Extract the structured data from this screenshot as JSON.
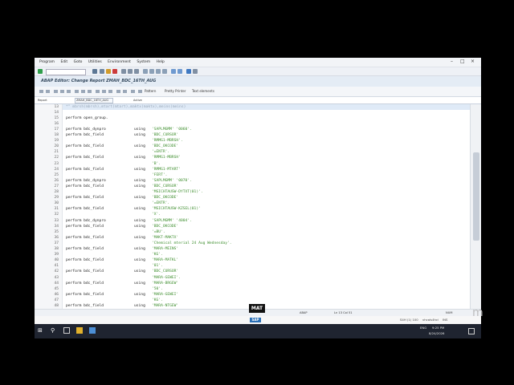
{
  "menu": [
    "Program",
    "Edit",
    "Goto",
    "Utilities",
    "Environment",
    "System",
    "Help"
  ],
  "window_title": "ABAP Editor: Change Report ZMAH_BDC_16TH_AUG",
  "toolbar2_labels": [
    "Pattern",
    "Pretty Printer",
    "Text elements"
  ],
  "info": {
    "report_label": "Report",
    "report_value": "ZMAH_BDC_16TH_AUG",
    "status": "Active"
  },
  "code_lines": [
    {
      "num": "13",
      "text": "*\" mbrsh(mbrsh),mtart(mtart),maktx(maktx),meins(meins)"
    },
    {
      "num": "14",
      "text": ""
    },
    {
      "num": "15",
      "text": "perform open_group."
    },
    {
      "num": "16",
      "text": ""
    },
    {
      "num": "17",
      "a": "perform bdc_dynpro",
      "b": "using",
      "c": "'SAPLMGMM' '0060'."
    },
    {
      "num": "18",
      "a": "perform bdc_field",
      "b": "using",
      "c": "'BDC_CURSOR'"
    },
    {
      "num": "19",
      "a": "",
      "b": "",
      "c": "'RMMG1-MBRSH'."
    },
    {
      "num": "20",
      "a": "perform bdc_field",
      "b": "using",
      "c": "'BDC_OKCODE'"
    },
    {
      "num": "21",
      "a": "",
      "b": "",
      "c": "'=ENTR'."
    },
    {
      "num": "22",
      "a": "perform bdc_field",
      "b": "using",
      "c": "'RMMG1-MBRSH'"
    },
    {
      "num": "23",
      "a": "",
      "b": "",
      "c": "'B'."
    },
    {
      "num": "24",
      "a": "perform bdc_field",
      "b": "using",
      "c": "'RMMG1-MTART'"
    },
    {
      "num": "25",
      "a": "",
      "b": "",
      "c": "'FERT'."
    },
    {
      "num": "26",
      "a": "perform bdc_dynpro",
      "b": "using",
      "c": "'SAPLMGMM' '0070'."
    },
    {
      "num": "27",
      "a": "perform bdc_field",
      "b": "using",
      "c": "'BDC_CURSOR'"
    },
    {
      "num": "28",
      "a": "",
      "b": "",
      "c": "'MSICHTAUSW-DYTXT(01)'."
    },
    {
      "num": "29",
      "a": "perform bdc_field",
      "b": "using",
      "c": "'BDC_OKCODE'"
    },
    {
      "num": "30",
      "a": "",
      "b": "",
      "c": "'=ENTR'."
    },
    {
      "num": "31",
      "a": "perform bdc_field",
      "b": "using",
      "c": "'MSICHTAUSW-KZSEL(01)'"
    },
    {
      "num": "32",
      "a": "",
      "b": "",
      "c": "'X'."
    },
    {
      "num": "33",
      "a": "perform bdc_dynpro",
      "b": "using",
      "c": "'SAPLMGMM' '4004'."
    },
    {
      "num": "34",
      "a": "perform bdc_field",
      "b": "using",
      "c": "'BDC_OKCODE'"
    },
    {
      "num": "35",
      "a": "",
      "b": "",
      "c": "'=BU'."
    },
    {
      "num": "36",
      "a": "perform bdc_field",
      "b": "using",
      "c": "'MAKT-MAKTX'"
    },
    {
      "num": "37",
      "a": "",
      "b": "",
      "c": "'Chemical mterial 24 Aug Wednesday'."
    },
    {
      "num": "38",
      "a": "perform bdc_field",
      "b": "using",
      "c": "'MARA-MEINS'"
    },
    {
      "num": "39",
      "a": "",
      "b": "",
      "c": "'KG'."
    },
    {
      "num": "40",
      "a": "perform bdc_field",
      "b": "using",
      "c": "'MARA-MATKL'"
    },
    {
      "num": "41",
      "a": "",
      "b": "",
      "c": "'01'."
    },
    {
      "num": "42",
      "a": "perform bdc_field",
      "b": "using",
      "c": "'BDC_CURSOR'"
    },
    {
      "num": "43",
      "a": "",
      "b": "",
      "c": "'MARA-GEWEI'."
    },
    {
      "num": "44",
      "a": "perform bdc_field",
      "b": "using",
      "c": "'MARA-BRGEW'"
    },
    {
      "num": "45",
      "a": "",
      "b": "",
      "c": "'50'."
    },
    {
      "num": "46",
      "a": "perform bdc_field",
      "b": "using",
      "c": "'MARA-GEWEI'"
    },
    {
      "num": "47",
      "a": "",
      "b": "",
      "c": "'KG'."
    },
    {
      "num": "48",
      "a": "perform bdc_field",
      "b": "using",
      "c": "'MARA-NTGEW'"
    }
  ],
  "status": {
    "lang": "ABAP",
    "pos": "Ln 13 Col 51",
    "mode": "NUM",
    "sys": "S4H (1) 100",
    "host": "vhcals4hci",
    "ins": "INS"
  },
  "overlay": {
    "mat": "MAT"
  },
  "tray": {
    "lang": "ENG",
    "time": "9:25 PM",
    "date": "8/24/2026"
  },
  "colors": {
    "accent": "#2a6fb6",
    "literal": "#3f8f2f"
  }
}
